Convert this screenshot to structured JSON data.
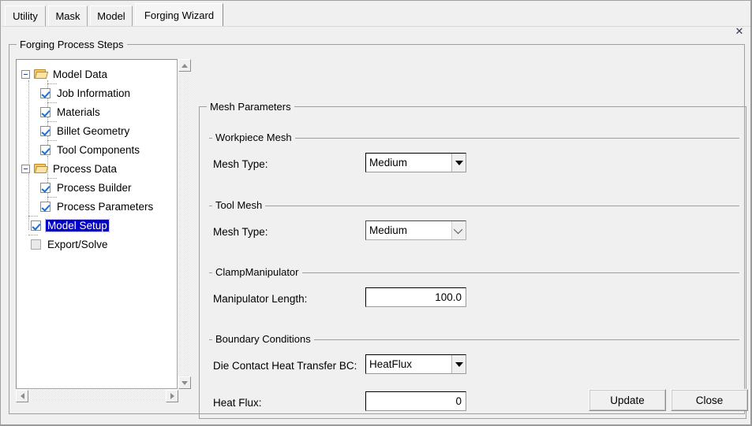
{
  "window": {
    "close_icon": "close-icon",
    "close_glyph": "✕"
  },
  "tabs": [
    {
      "label": "Utility",
      "active": false
    },
    {
      "label": "Mask",
      "active": false
    },
    {
      "label": "Model",
      "active": false
    },
    {
      "label": "Forging Wizard",
      "active": true
    }
  ],
  "steps_group": {
    "title": "Forging Process Steps"
  },
  "tree": {
    "nodes": [
      {
        "label": "Model Data",
        "type": "folder",
        "level": 1,
        "expanded": true
      },
      {
        "label": "Job Information",
        "type": "checkbox",
        "level": 2,
        "checked": true,
        "selected": false
      },
      {
        "label": "Materials",
        "type": "checkbox",
        "level": 2,
        "checked": true,
        "selected": false
      },
      {
        "label": "Billet Geometry",
        "type": "checkbox",
        "level": 2,
        "checked": true,
        "selected": false
      },
      {
        "label": "Tool Components",
        "type": "checkbox",
        "level": 2,
        "checked": true,
        "selected": false
      },
      {
        "label": "Process Data",
        "type": "folder",
        "level": 1,
        "expanded": true
      },
      {
        "label": "Process Builder",
        "type": "checkbox",
        "level": 2,
        "checked": true,
        "selected": false
      },
      {
        "label": "Process Parameters",
        "type": "checkbox",
        "level": 2,
        "checked": true,
        "selected": false
      },
      {
        "label": "Model Setup",
        "type": "checkbox",
        "level": 1.5,
        "checked": true,
        "selected": true
      },
      {
        "label": "Export/Solve",
        "type": "checkbox",
        "level": 1.5,
        "checked": false,
        "selected": false,
        "disabled": true
      }
    ],
    "selection_color": "#0000c8",
    "folder_color": "#f3c96b"
  },
  "mesh_panel": {
    "title": "Mesh Parameters",
    "sections": [
      {
        "title": "Workpiece Mesh"
      },
      {
        "title": "Tool Mesh"
      },
      {
        "title": "ClampManipulator"
      },
      {
        "title": "Boundary Conditions"
      }
    ],
    "fields": [
      {
        "label": "Mesh Type:",
        "control": "combo",
        "value": "Medium",
        "style": "normal"
      },
      {
        "label": "Mesh Type:",
        "control": "combo",
        "value": "Medium",
        "style": "alt"
      },
      {
        "label": "Manipulator Length:",
        "control": "text",
        "value": "100.0"
      },
      {
        "label": "Die Contact Heat Transfer BC:",
        "control": "combo",
        "value": "HeatFlux",
        "style": "normal"
      },
      {
        "label": "Heat Flux:",
        "control": "text",
        "value": "0"
      }
    ]
  },
  "buttons": {
    "update": "Update",
    "close": "Close"
  },
  "scrollbars": {
    "vertical_up": "scroll-up-arrow",
    "vertical_down": "scroll-down-arrow",
    "horizontal_left": "scroll-left-arrow",
    "horizontal_right": "scroll-right-arrow"
  }
}
